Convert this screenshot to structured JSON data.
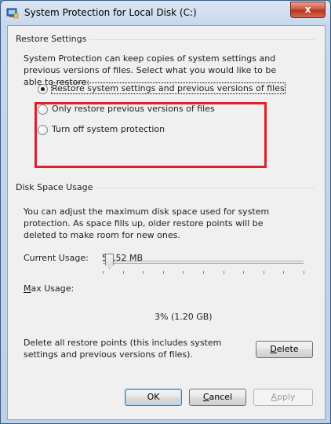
{
  "window": {
    "title": "System Protection for Local Disk (C:)",
    "close_glyph": "x",
    "icon": "system-protection-icon"
  },
  "restore_settings": {
    "heading": "Restore Settings",
    "description": "System Protection can keep copies of system settings and previous versions of files. Select what you would like to be able to restore:",
    "options": [
      {
        "label": "Restore system settings and previous versions of files",
        "checked": true
      },
      {
        "label": "Only restore previous versions of files",
        "checked": false
      },
      {
        "label": "Turn off system protection",
        "checked": false
      }
    ]
  },
  "disk_space": {
    "heading": "Disk Space Usage",
    "description": "You can adjust the maximum disk space used for system protection. As space fills up, older restore points will be deleted to make room for new ones.",
    "current_usage_label": "Current Usage:",
    "current_usage_value": "59.52 MB",
    "max_usage_label": "Max Usage:",
    "max_usage_value": "3% (1.20 GB)",
    "max_usage_percent": 3,
    "delete_text": "Delete all restore points (this includes system settings and previous versions of files).",
    "delete_label": "Delete"
  },
  "buttons": {
    "ok": "OK",
    "cancel": "Cancel",
    "apply": "Apply"
  },
  "colors": {
    "highlight": "#e0202a",
    "close_button": "#c7503a"
  }
}
